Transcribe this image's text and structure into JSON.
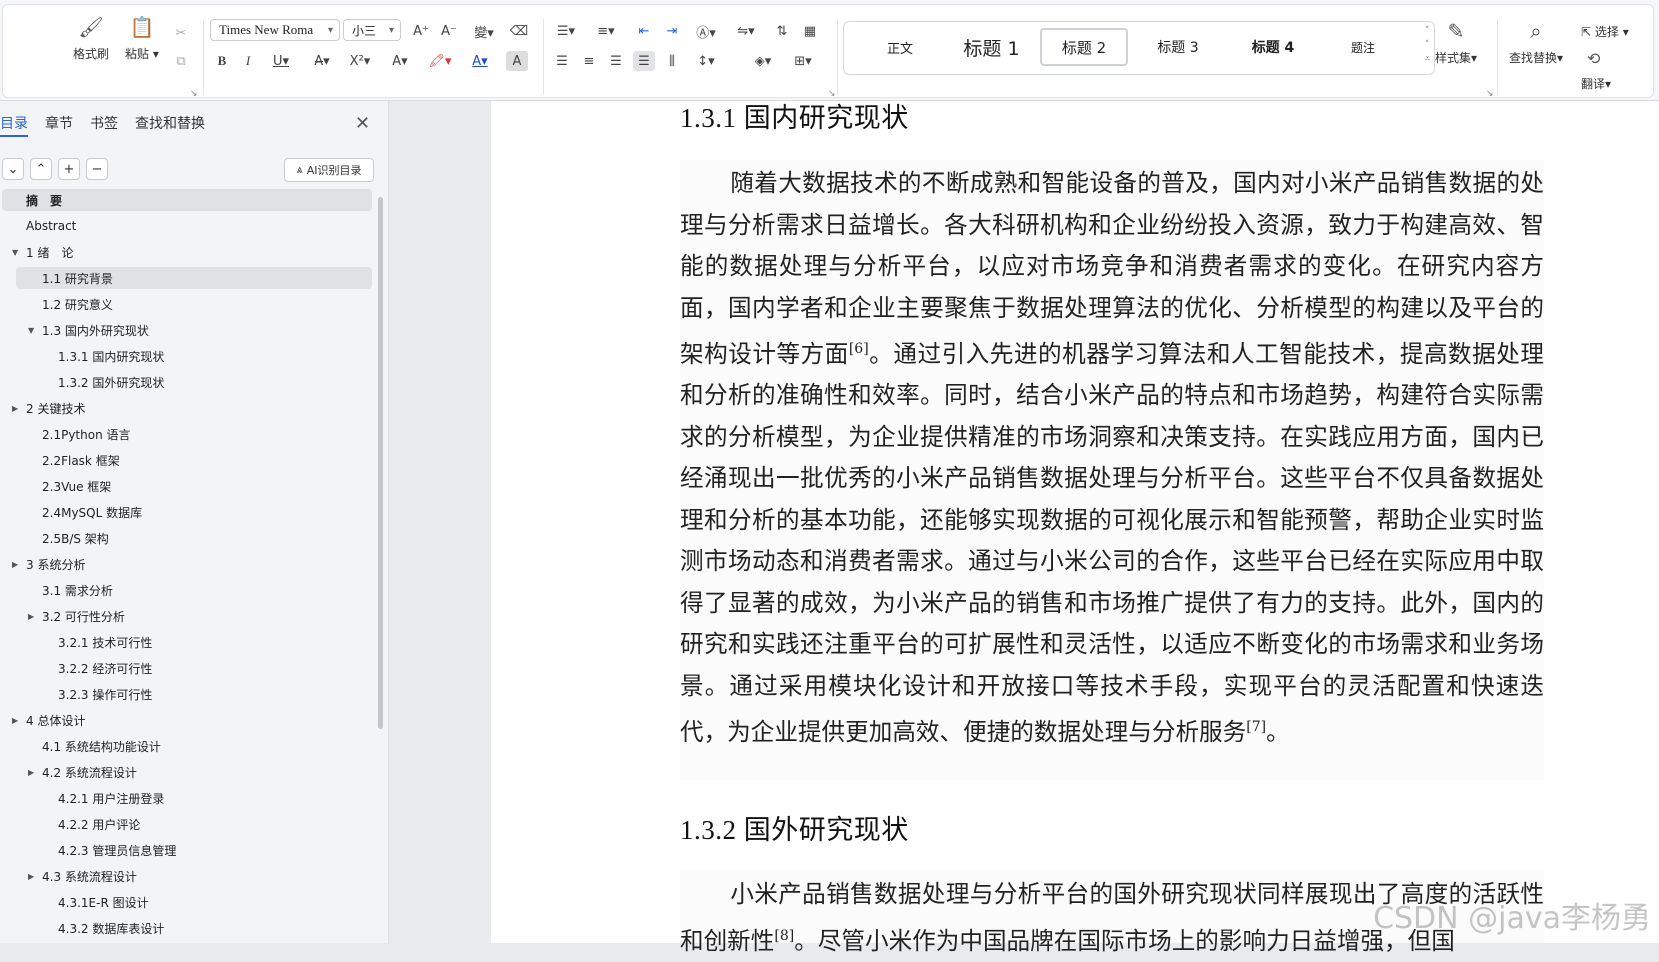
{
  "ribbon": {
    "format_painter": "格式刷",
    "paste": "粘贴",
    "font_name": "Times New Roma",
    "font_size": "小三",
    "bold": "B",
    "italic": "I",
    "underline": "U",
    "style_gallery": [
      "正文",
      "标题 1",
      "标题 2",
      "标题 3",
      "标题 4",
      "题注"
    ],
    "style_set": "样式集",
    "find_replace": "查找替换",
    "select": "选择",
    "translate": "翻译"
  },
  "nav_panel": {
    "tabs": [
      "目录",
      "章节",
      "书签",
      "查找和替换"
    ],
    "active_tab": "目录",
    "ai_button": "AI识别目录",
    "toc": [
      {
        "label": "摘　要",
        "level": 0,
        "highlight": true
      },
      {
        "label": "Abstract",
        "level": 0
      },
      {
        "label": "1 绪　论",
        "level": 0,
        "expanded": true
      },
      {
        "label": "1.1 研究背景",
        "level": 1,
        "highlight": true
      },
      {
        "label": "1.2 研究意义",
        "level": 1
      },
      {
        "label": "1.3 国内外研究现状",
        "level": 1,
        "expanded": true
      },
      {
        "label": "1.3.1 国内研究现状",
        "level": 2
      },
      {
        "label": "1.3.2 国外研究现状",
        "level": 2
      },
      {
        "label": "2 关键技术",
        "level": 0,
        "collapsed": true
      },
      {
        "label": "2.1Python 语言",
        "level": 1
      },
      {
        "label": "2.2Flask 框架",
        "level": 1
      },
      {
        "label": "2.3Vue 框架",
        "level": 1
      },
      {
        "label": "2.4MySQL 数据库",
        "level": 1
      },
      {
        "label": "2.5B/S 架构",
        "level": 1
      },
      {
        "label": "3 系统分析",
        "level": 0,
        "collapsed": true
      },
      {
        "label": "3.1 需求分析",
        "level": 1
      },
      {
        "label": "3.2 可行性分析",
        "level": 1,
        "collapsed": true
      },
      {
        "label": "3.2.1 技术可行性",
        "level": 2
      },
      {
        "label": "3.2.2 经济可行性",
        "level": 2
      },
      {
        "label": "3.2.3 操作可行性",
        "level": 2
      },
      {
        "label": "4 总体设计",
        "level": 0,
        "collapsed": true
      },
      {
        "label": "4.1 系统结构功能设计",
        "level": 1
      },
      {
        "label": "4.2 系统流程设计",
        "level": 1,
        "collapsed": true
      },
      {
        "label": "4.2.1 用户注册登录",
        "level": 2
      },
      {
        "label": "4.2.2 用户评论",
        "level": 2
      },
      {
        "label": "4.2.3 管理员信息管理",
        "level": 2
      },
      {
        "label": "4.3 系统流程设计",
        "level": 1,
        "collapsed": true
      },
      {
        "label": "4.3.1E-R 图设计",
        "level": 2
      },
      {
        "label": "4.3.2 数据库表设计",
        "level": 2
      }
    ]
  },
  "document": {
    "heading1": "1.3.1 国内研究现状",
    "para1_a": "随着大数据技术的不断成熟和智能设备的普及，国内对小米产品销售数据的处理与分析需求日益增长。各大科研机构和企业纷纷投入资源，致力于构建高效、智能的数据处理与分析平台，以应对市场竞争和消费者需求的变化。在研究内容方面，国内学者和企业主要聚焦于数据处理算法的优化、分析模型的构建以及平台的架构设计等方面",
    "para1_ref1": "[6]",
    "para1_b": "。通过引入先进的机器学习算法和人工智能技术，提高数据处理和分析的准确性和效率。同时，结合小米产品的特点和市场趋势，构建符合实际需求的分析模型，为企业提供精准的市场洞察和决策支持。在实践应用方面，国内已经涌现出一批优秀的小米产品销售数据处理与分析平台。这些平台不仅具备数据处理和分析的基本功能，还能够实现数据的可视化展示和智能预警，帮助企业实时监测市场动态和消费者需求。通过与小米公司的合作，这些平台已经在实际应用中取得了显著的成效，为小米产品的销售和市场推广提供了有力的支持。此外，国内的研究和实践还注重平台的可扩展性和灵活性，以适应不断变化的市场需求和业务场景。通过采用模块化设计和开放接口等技术手段，实现平台的灵活配置和快速迭代，为企业提供更加高效、便捷的数据处理与分析服务",
    "para1_ref2": "[7]",
    "para1_end": "。",
    "heading2": "1.3.2 国外研究现状",
    "para2_a": "小米产品销售数据处理与分析平台的国外研究现状同样展现出了高度的活跃性和创新性",
    "para2_ref": "[8]",
    "para2_b": "。尽管小米作为中国品牌在国际市场上的影响力日益增强，但国"
  },
  "watermark": "CSDN @java李杨勇"
}
